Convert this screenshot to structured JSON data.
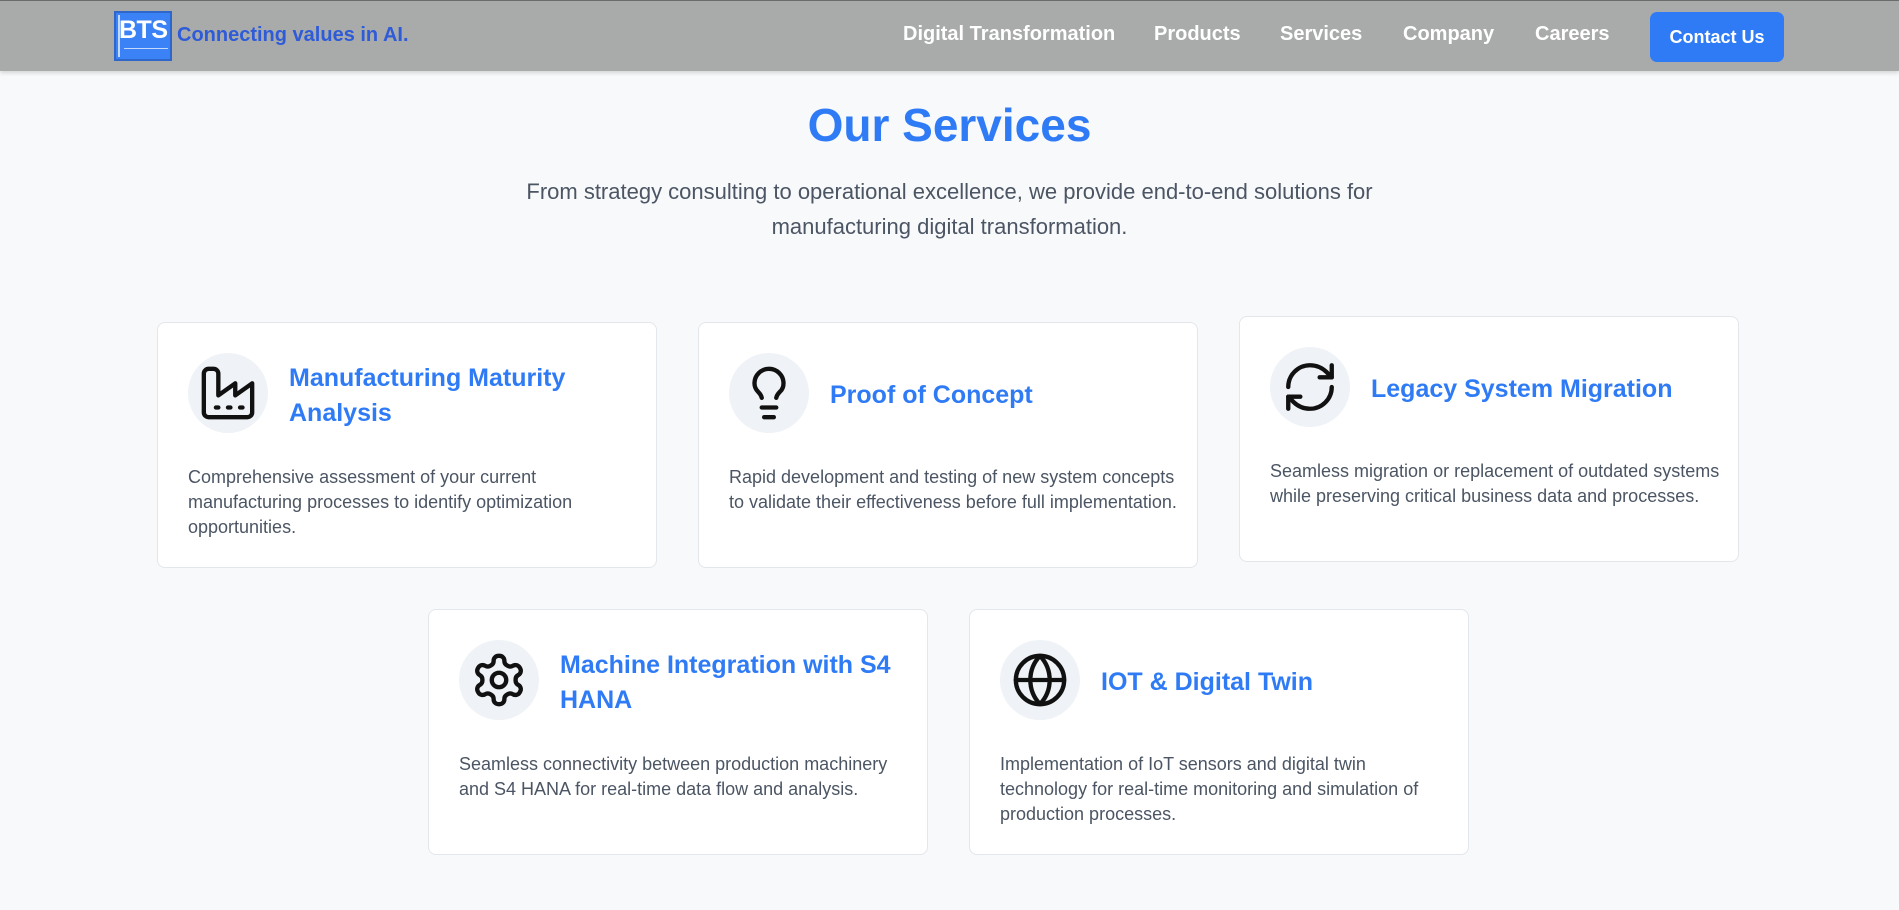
{
  "header": {
    "logo_text": "BTS",
    "logo_subtext": "CONNECTING VALUES",
    "tagline": "Connecting values in AI.",
    "nav": [
      {
        "label": "Digital Transformation"
      },
      {
        "label": "Products"
      },
      {
        "label": "Services"
      },
      {
        "label": "Company"
      },
      {
        "label": "Careers"
      }
    ],
    "contact_label": "Contact Us"
  },
  "section": {
    "title": "Our Services",
    "subtitle": "From strategy consulting to operational excellence, we provide end-to-end solutions for manufacturing digital transformation."
  },
  "services": [
    {
      "icon": "factory-icon",
      "title": "Manufacturing Maturity Analysis",
      "description": "Comprehensive assessment of your current manufacturing processes to identify optimization opportunities."
    },
    {
      "icon": "lightbulb-icon",
      "title": "Proof of Concept",
      "description": "Rapid development and testing of new system concepts to validate their effectiveness before full implementation."
    },
    {
      "icon": "refresh-icon",
      "title": "Legacy System Migration",
      "description": "Seamless migration or replacement of outdated systems while preserving critical business data and processes."
    },
    {
      "icon": "gear-icon",
      "title": "Machine Integration with S4 HANA",
      "description": "Seamless connectivity between production machinery and S4 HANA for real-time data flow and analysis."
    },
    {
      "icon": "globe-icon",
      "title": "IOT & Digital Twin",
      "description": "Implementation of IoT sensors and digital twin technology for real-time monitoring and simulation of production processes."
    }
  ],
  "colors": {
    "accent": "#2f7bf5",
    "header_bg": "#a9abab",
    "tagline": "#2e5bd8",
    "page_bg": "#f8f9fb"
  }
}
